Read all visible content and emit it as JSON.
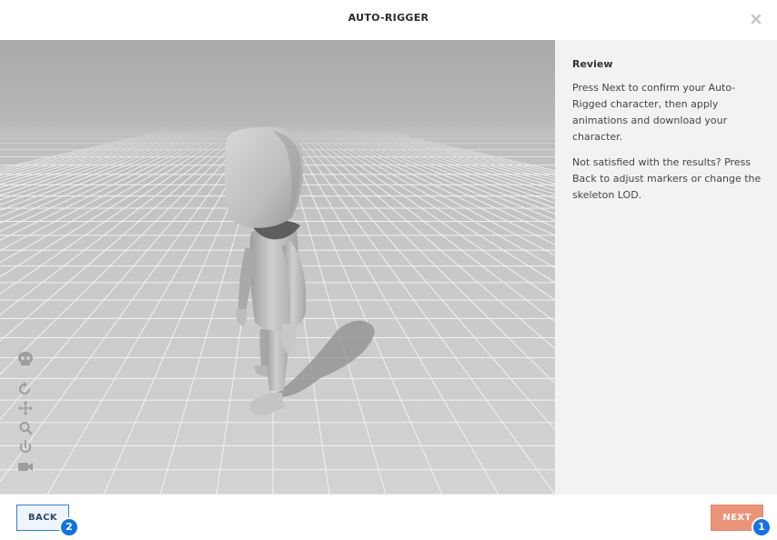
{
  "dialog": {
    "title": "AUTO-RIGGER"
  },
  "icons": {
    "close": "close-icon",
    "toolbar": [
      "skull-icon",
      "rotate-icon",
      "move-icon",
      "zoom-icon",
      "power-icon",
      "camera-icon"
    ]
  },
  "panel": {
    "heading": "Review",
    "paragraph1": "Press Next to confirm your Auto-Rigged character, then apply animations and download your character.",
    "paragraph2": "Not satisfied with the results? Press Back to adjust markers or change the skeleton LOD."
  },
  "footer": {
    "back_label": "BACK",
    "back_badge": "2",
    "next_label": "NEXT",
    "next_badge": "1"
  },
  "colors": {
    "accent_blue": "#1273e6",
    "next_button": "#ec9478",
    "panel_bg": "#f1f3f2"
  }
}
